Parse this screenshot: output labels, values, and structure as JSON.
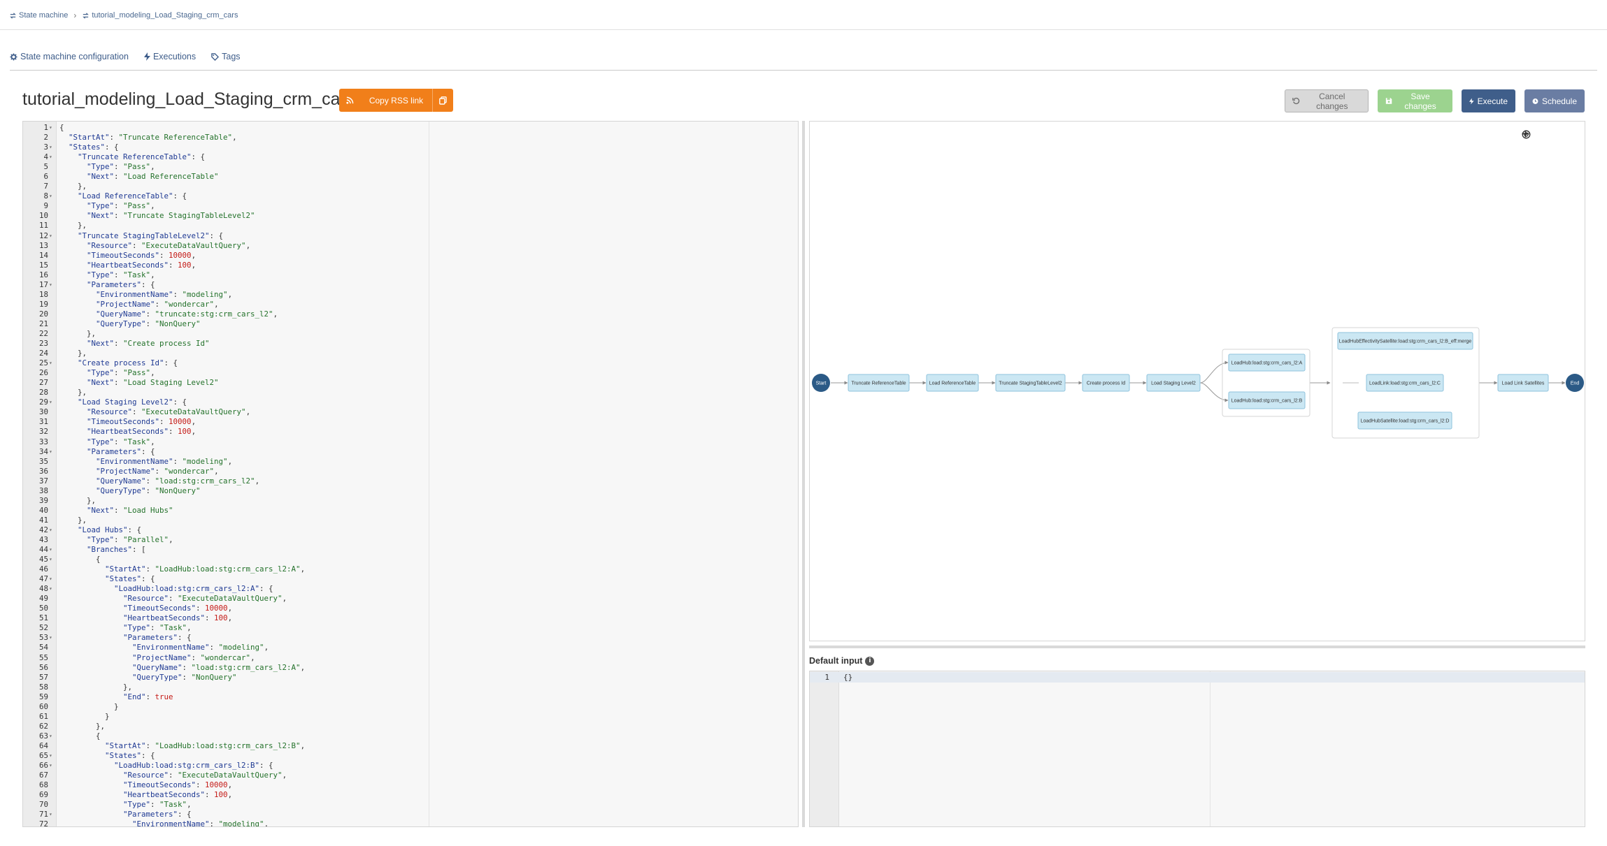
{
  "breadcrumb": {
    "root": "State machine",
    "current": "tutorial_modeling_Load_Staging_crm_cars"
  },
  "tabs": [
    {
      "label": "State machine configuration",
      "icon": "gear-icon"
    },
    {
      "label": "Executions",
      "icon": "bolt-icon"
    },
    {
      "label": "Tags",
      "icon": "tag-icon"
    }
  ],
  "title": "tutorial_modeling_Load_Staging_crm_cars",
  "rss": {
    "label": "Copy RSS link"
  },
  "actions": {
    "cancel": "Cancel changes",
    "save": "Save changes",
    "execute": "Execute",
    "schedule": "Schedule"
  },
  "colors": {
    "accent": "#3f5e8a",
    "rss": "#f17f1a",
    "save": "#9cd38f",
    "node_fill": "#cbe7f3",
    "node_stroke": "#8fc3dc",
    "terminal": "#2b5a86"
  },
  "code": [
    {
      "ln": "1",
      "fold": true,
      "t": "{"
    },
    {
      "ln": "2",
      "t": "  \"StartAt\": \"Truncate ReferenceTable\","
    },
    {
      "ln": "3",
      "fold": true,
      "t": "  \"States\": {"
    },
    {
      "ln": "4",
      "fold": true,
      "t": "    \"Truncate ReferenceTable\": {"
    },
    {
      "ln": "5",
      "t": "      \"Type\": \"Pass\","
    },
    {
      "ln": "6",
      "t": "      \"Next\": \"Load ReferenceTable\""
    },
    {
      "ln": "7",
      "t": "    },"
    },
    {
      "ln": "8",
      "fold": true,
      "t": "    \"Load ReferenceTable\": {"
    },
    {
      "ln": "9",
      "t": "      \"Type\": \"Pass\","
    },
    {
      "ln": "10",
      "t": "      \"Next\": \"Truncate StagingTableLevel2\""
    },
    {
      "ln": "11",
      "t": "    },"
    },
    {
      "ln": "12",
      "fold": true,
      "t": "    \"Truncate StagingTableLevel2\": {"
    },
    {
      "ln": "13",
      "t": "      \"Resource\": \"ExecuteDataVaultQuery\","
    },
    {
      "ln": "14",
      "t": "      \"TimeoutSeconds\": 10000,"
    },
    {
      "ln": "15",
      "t": "      \"HeartbeatSeconds\": 100,"
    },
    {
      "ln": "16",
      "t": "      \"Type\": \"Task\","
    },
    {
      "ln": "17",
      "fold": true,
      "t": "      \"Parameters\": {"
    },
    {
      "ln": "18",
      "t": "        \"EnvironmentName\": \"modeling\","
    },
    {
      "ln": "19",
      "t": "        \"ProjectName\": \"wondercar\","
    },
    {
      "ln": "20",
      "t": "        \"QueryName\": \"truncate:stg:crm_cars_l2\","
    },
    {
      "ln": "21",
      "t": "        \"QueryType\": \"NonQuery\""
    },
    {
      "ln": "22",
      "t": "      },"
    },
    {
      "ln": "23",
      "t": "      \"Next\": \"Create process Id\""
    },
    {
      "ln": "24",
      "t": "    },"
    },
    {
      "ln": "25",
      "fold": true,
      "t": "    \"Create process Id\": {"
    },
    {
      "ln": "26",
      "t": "      \"Type\": \"Pass\","
    },
    {
      "ln": "27",
      "t": "      \"Next\": \"Load Staging Level2\""
    },
    {
      "ln": "28",
      "t": "    },"
    },
    {
      "ln": "29",
      "fold": true,
      "t": "    \"Load Staging Level2\": {"
    },
    {
      "ln": "30",
      "t": "      \"Resource\": \"ExecuteDataVaultQuery\","
    },
    {
      "ln": "31",
      "t": "      \"TimeoutSeconds\": 10000,"
    },
    {
      "ln": "32",
      "t": "      \"HeartbeatSeconds\": 100,"
    },
    {
      "ln": "33",
      "t": "      \"Type\": \"Task\","
    },
    {
      "ln": "34",
      "fold": true,
      "t": "      \"Parameters\": {"
    },
    {
      "ln": "35",
      "t": "        \"EnvironmentName\": \"modeling\","
    },
    {
      "ln": "36",
      "t": "        \"ProjectName\": \"wondercar\","
    },
    {
      "ln": "37",
      "t": "        \"QueryName\": \"load:stg:crm_cars_l2\","
    },
    {
      "ln": "38",
      "t": "        \"QueryType\": \"NonQuery\""
    },
    {
      "ln": "39",
      "t": "      },"
    },
    {
      "ln": "40",
      "t": "      \"Next\": \"Load Hubs\""
    },
    {
      "ln": "41",
      "t": "    },"
    },
    {
      "ln": "42",
      "fold": true,
      "t": "    \"Load Hubs\": {"
    },
    {
      "ln": "43",
      "t": "      \"Type\": \"Parallel\","
    },
    {
      "ln": "44",
      "fold": true,
      "t": "      \"Branches\": ["
    },
    {
      "ln": "45",
      "fold": true,
      "t": "        {"
    },
    {
      "ln": "46",
      "t": "          \"StartAt\": \"LoadHub:load:stg:crm_cars_l2:A\","
    },
    {
      "ln": "47",
      "fold": true,
      "t": "          \"States\": {"
    },
    {
      "ln": "48",
      "fold": true,
      "t": "            \"LoadHub:load:stg:crm_cars_l2:A\": {"
    },
    {
      "ln": "49",
      "t": "              \"Resource\": \"ExecuteDataVaultQuery\","
    },
    {
      "ln": "50",
      "t": "              \"TimeoutSeconds\": 10000,"
    },
    {
      "ln": "51",
      "t": "              \"HeartbeatSeconds\": 100,"
    },
    {
      "ln": "52",
      "t": "              \"Type\": \"Task\","
    },
    {
      "ln": "53",
      "fold": true,
      "t": "              \"Parameters\": {"
    },
    {
      "ln": "54",
      "t": "                \"EnvironmentName\": \"modeling\","
    },
    {
      "ln": "55",
      "t": "                \"ProjectName\": \"wondercar\","
    },
    {
      "ln": "56",
      "t": "                \"QueryName\": \"load:stg:crm_cars_l2:A\","
    },
    {
      "ln": "57",
      "t": "                \"QueryType\": \"NonQuery\""
    },
    {
      "ln": "58",
      "t": "              },"
    },
    {
      "ln": "59",
      "t": "              \"End\": true"
    },
    {
      "ln": "60",
      "t": "            }"
    },
    {
      "ln": "61",
      "t": "          }"
    },
    {
      "ln": "62",
      "t": "        },"
    },
    {
      "ln": "63",
      "fold": true,
      "t": "        {"
    },
    {
      "ln": "64",
      "t": "          \"StartAt\": \"LoadHub:load:stg:crm_cars_l2:B\","
    },
    {
      "ln": "65",
      "fold": true,
      "t": "          \"States\": {"
    },
    {
      "ln": "66",
      "fold": true,
      "t": "            \"LoadHub:load:stg:crm_cars_l2:B\": {"
    },
    {
      "ln": "67",
      "t": "              \"Resource\": \"ExecuteDataVaultQuery\","
    },
    {
      "ln": "68",
      "t": "              \"TimeoutSeconds\": 10000,"
    },
    {
      "ln": "69",
      "t": "              \"HeartbeatSeconds\": 100,"
    },
    {
      "ln": "70",
      "t": "              \"Type\": \"Task\","
    },
    {
      "ln": "71",
      "fold": true,
      "t": "              \"Parameters\": {"
    },
    {
      "ln": "72",
      "t": "                \"EnvironmentName\": \"modeling\","
    }
  ],
  "graph": {
    "start": "Start",
    "end": "End",
    "nodes": {
      "truncate_ref": "Truncate ReferenceTable",
      "load_ref": "Load ReferenceTable",
      "truncate_stg": "Truncate StagingTableLevel2",
      "create_pid": "Create process Id",
      "load_stg": "Load Staging Level2",
      "hub_a": "LoadHub:load:stg:crm_cars_l2:A",
      "hub_b": "LoadHub:load:stg:crm_cars_l2:B",
      "hub_eff_sat": "LoadHubEffectivitySatellite:load:stg:crm_cars_l2:B_eff:merge",
      "link": "LoadLink:load:stg:crm_cars_l2:C",
      "hub_sat": "LoadHubSatellite:load:stg:crm_cars_l2:D",
      "load_link_sats": "Load Link Satellites"
    }
  },
  "default_input": {
    "label": "Default input",
    "line": "1",
    "value": "{}"
  }
}
